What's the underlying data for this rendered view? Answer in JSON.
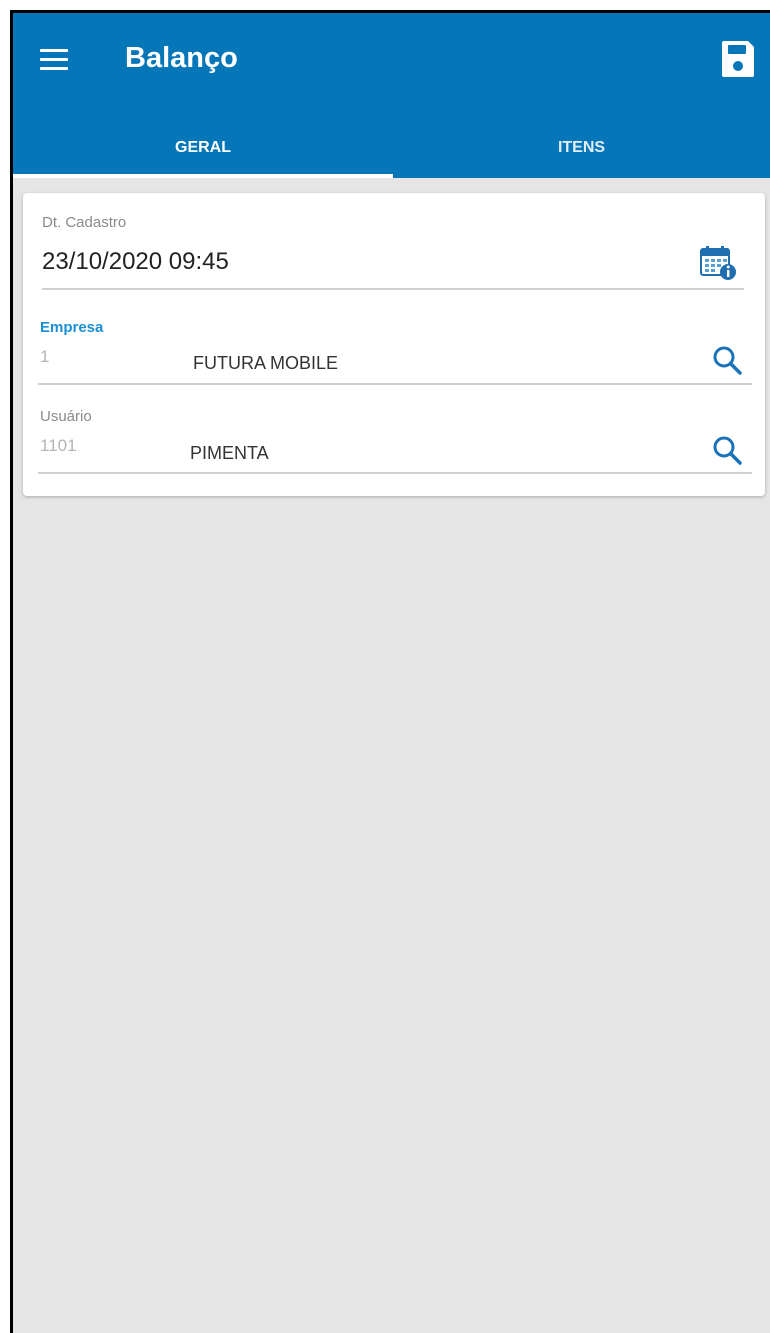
{
  "header": {
    "title": "Balanço",
    "menu_icon": "hamburger-menu-icon",
    "save_icon": "floppy-disk-icon",
    "background": "#0576b8"
  },
  "tabs": [
    {
      "label": "GERAL",
      "active": true
    },
    {
      "label": "ITENS",
      "active": false
    }
  ],
  "form": {
    "dt_cadastro": {
      "label": "Dt. Cadastro",
      "value": "23/10/2020 09:45",
      "icon": "calendar-info-icon"
    },
    "empresa": {
      "label": "Empresa",
      "code": "1",
      "name": "FUTURA MOBILE",
      "icon": "search-icon"
    },
    "usuario": {
      "label": "Usuário",
      "code": "1101",
      "name": "PIMENTA",
      "icon": "search-icon"
    }
  },
  "colors": {
    "accent": "#1a8fd6",
    "page_background": "#e5e5e5"
  }
}
